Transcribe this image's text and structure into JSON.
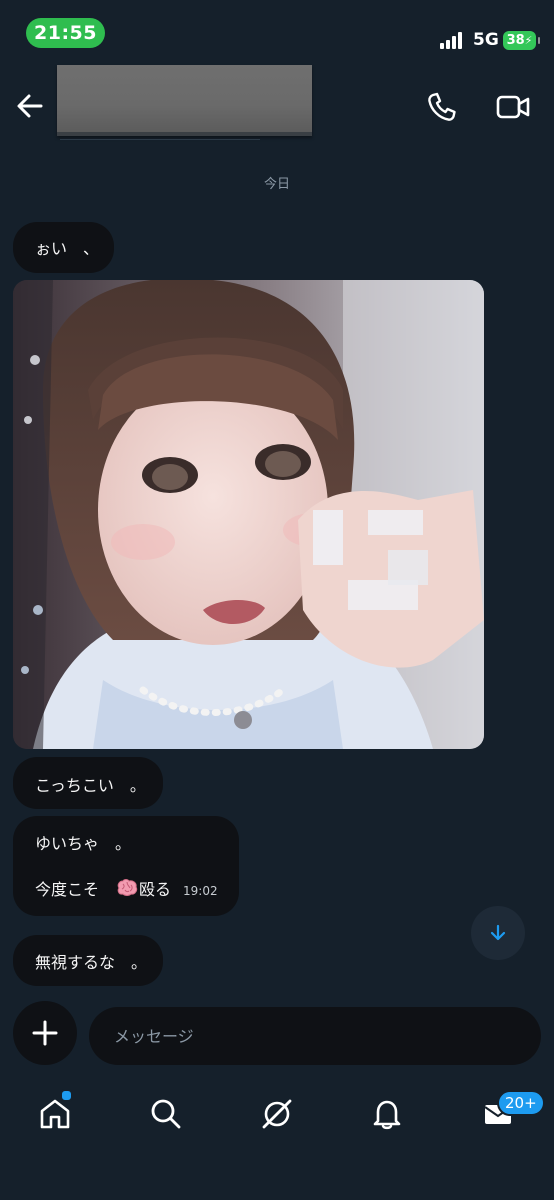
{
  "status_bar": {
    "time": "21:55",
    "network": "5G",
    "battery": "38"
  },
  "header": {
    "back_icon": "arrow-left-icon",
    "call_icon": "phone-icon",
    "video_icon": "video-camera-icon"
  },
  "conversation": {
    "date_separator": "今日",
    "messages": [
      {
        "text": "ぉい　、"
      },
      {
        "type": "image"
      },
      {
        "text": "こっちこい　。"
      },
      {
        "line1": "ゆいちゃ　。",
        "line2_prefix": "今度こそ　",
        "emoji": "brain-emoji",
        "line2_suffix": "殴る",
        "time": "19:02"
      },
      {
        "text": "無視するな　。"
      }
    ]
  },
  "composer": {
    "placeholder": "メッセージ",
    "add_icon": "plus-icon"
  },
  "scroll_button": {
    "icon": "arrow-down-icon"
  },
  "tab_bar": {
    "items": [
      {
        "icon": "home-icon",
        "has_dot": true
      },
      {
        "icon": "search-icon"
      },
      {
        "icon": "grok-icon"
      },
      {
        "icon": "bell-icon"
      },
      {
        "icon": "envelope-icon"
      }
    ],
    "messages_badge": "20+"
  },
  "colors": {
    "background": "#15202b",
    "bubble": "#0f1115",
    "accent": "#1d9bf0",
    "time_pill": "#2fbd4f",
    "battery": "#34c759"
  }
}
